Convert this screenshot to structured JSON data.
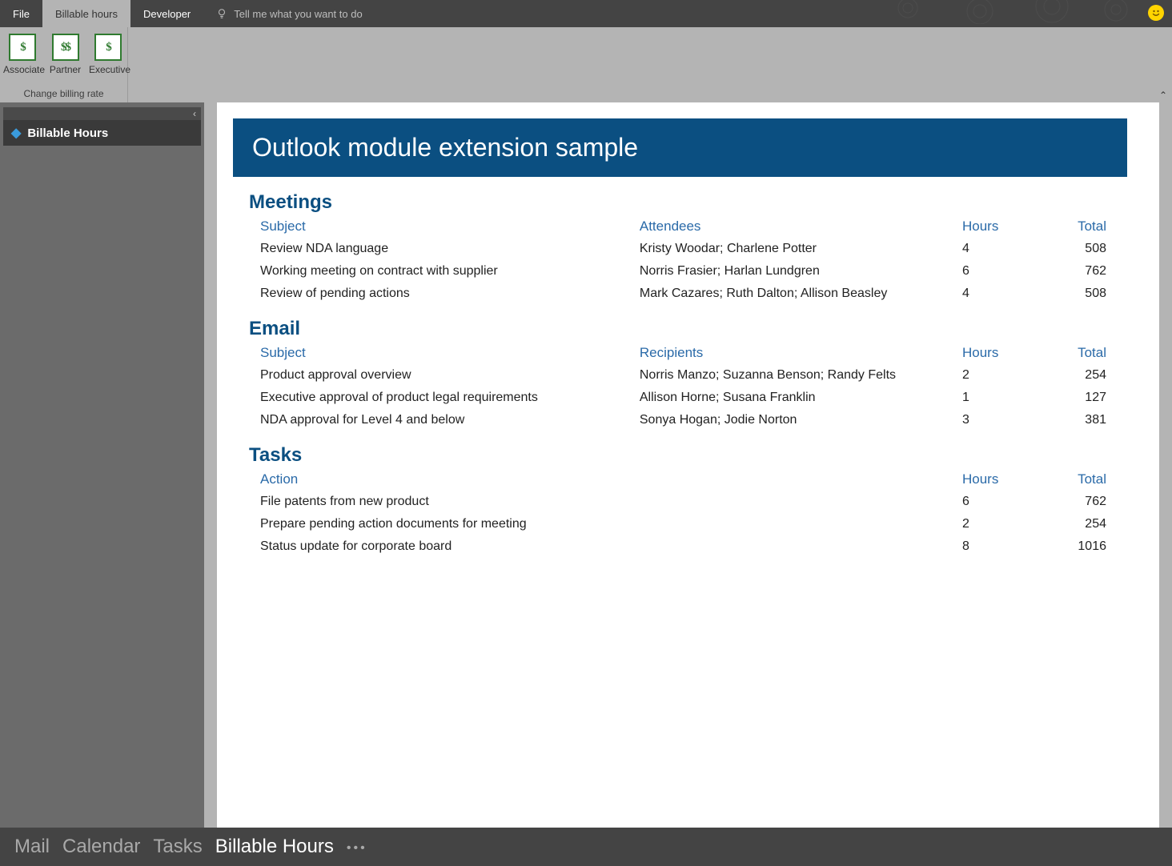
{
  "top_tabs": {
    "file": "File",
    "billable_hours": "Billable hours",
    "developer": "Developer"
  },
  "tellme": {
    "placeholder": "Tell me what you want to do"
  },
  "ribbon": {
    "group_label": "Change billing rate",
    "associate": {
      "label": "Associate",
      "glyph": "$"
    },
    "partner": {
      "label": "Partner",
      "glyph": "$$"
    },
    "executive": {
      "label": "Executive",
      "glyph": "$"
    }
  },
  "sidebar": {
    "active_module": "Billable Hours"
  },
  "page": {
    "title": "Outlook module extension sample"
  },
  "sections": {
    "meetings": {
      "title": "Meetings",
      "cols": {
        "subject": "Subject",
        "attendees": "Attendees",
        "hours": "Hours",
        "total": "Total"
      },
      "rows": [
        {
          "subject": "Review NDA language",
          "attendees": "Kristy Woodar; Charlene Potter",
          "hours": "4",
          "total": "508"
        },
        {
          "subject": "Working meeting on contract with supplier",
          "attendees": "Norris Frasier; Harlan Lundgren",
          "hours": "6",
          "total": "762"
        },
        {
          "subject": "Review of pending actions",
          "attendees": "Mark Cazares; Ruth Dalton; Allison Beasley",
          "hours": "4",
          "total": "508"
        }
      ]
    },
    "email": {
      "title": "Email",
      "cols": {
        "subject": "Subject",
        "recipients": "Recipients",
        "hours": "Hours",
        "total": "Total"
      },
      "rows": [
        {
          "subject": "Product approval overview",
          "recipients": "Norris Manzo; Suzanna Benson; Randy Felts",
          "hours": "2",
          "total": "254"
        },
        {
          "subject": "Executive approval of product legal requirements",
          "recipients": "Allison Horne; Susana Franklin",
          "hours": "1",
          "total": "127"
        },
        {
          "subject": "NDA approval for Level 4 and below",
          "recipients": "Sonya Hogan; Jodie Norton",
          "hours": "3",
          "total": "381"
        }
      ]
    },
    "tasks": {
      "title": "Tasks",
      "cols": {
        "action": "Action",
        "hours": "Hours",
        "total": "Total"
      },
      "rows": [
        {
          "action": "File patents from new product",
          "hours": "6",
          "total": "762"
        },
        {
          "action": "Prepare pending action documents for meeting",
          "hours": "2",
          "total": "254"
        },
        {
          "action": "Status update for corporate board",
          "hours": "8",
          "total": "1016"
        }
      ]
    }
  },
  "bottom_nav": {
    "mail": "Mail",
    "calendar": "Calendar",
    "tasks": "Tasks",
    "billable_hours": "Billable Hours"
  }
}
